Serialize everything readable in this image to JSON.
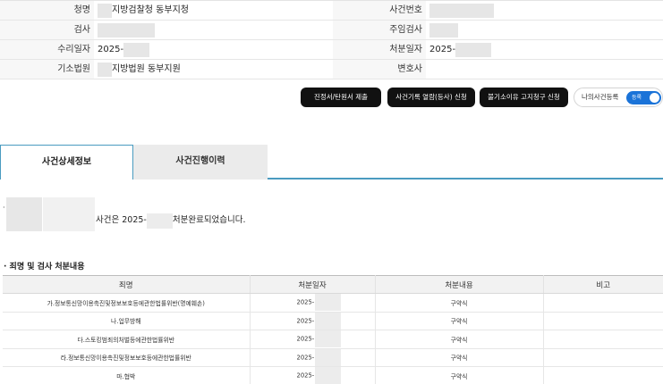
{
  "case_info": {
    "rows": [
      {
        "left_label": "청명",
        "left_value": "지방검찰청 동부지청",
        "right_label": "사건번호",
        "right_value": ""
      },
      {
        "left_label": "검사",
        "left_value": "",
        "right_label": "주임검사",
        "right_value": ""
      },
      {
        "left_label": "수리일자",
        "left_value": "2025-",
        "right_label": "처분일자",
        "right_value": "2025-"
      },
      {
        "left_label": "기소법원",
        "left_value": "지방법원 동부지원",
        "right_label": "변호사",
        "right_value": ""
      }
    ]
  },
  "actions": {
    "buttons": [
      "진정서/탄원서 제출",
      "사건기록 열람(등사) 신청",
      "불기소이유 고지청구 신청"
    ],
    "my_case_label": "나의사건등록",
    "my_case_toggle": "등록",
    "toggle_on": true
  },
  "tabs": {
    "active": "사건상세정보",
    "inactive": "사건진행이력"
  },
  "status": {
    "bullet": "·",
    "text_prefix": "사건은 2025-",
    "text_suffix": "처분완료되었습니다."
  },
  "charges": {
    "title": "· 죄명 및 검사 처분내용",
    "headers": [
      "죄명",
      "처분일자",
      "처분내용",
      "비고"
    ],
    "rows": [
      {
        "name": "가.정보통신망이용촉진및정보보호등에관한법률위반(명예훼손)",
        "date": "2025-",
        "result": "구약식",
        "note": ""
      },
      {
        "name": "나.업무방해",
        "date": "2025-",
        "result": "구약식",
        "note": ""
      },
      {
        "name": "다.스토킹범죄의처벌등에관한법률위반",
        "date": "2025-",
        "result": "구약식",
        "note": ""
      },
      {
        "name": "라.정보통신망이용촉진및정보보호등에관한법률위반",
        "date": "2025-",
        "result": "구약식",
        "note": ""
      },
      {
        "name": "마.협박",
        "date": "2025-",
        "result": "구약식",
        "note": ""
      }
    ]
  },
  "colors": {
    "button_bg": "#111111",
    "toggle_on": "#1a73d8",
    "tab_border": "#4a9bc0",
    "redaction": "#e6e6e6"
  }
}
